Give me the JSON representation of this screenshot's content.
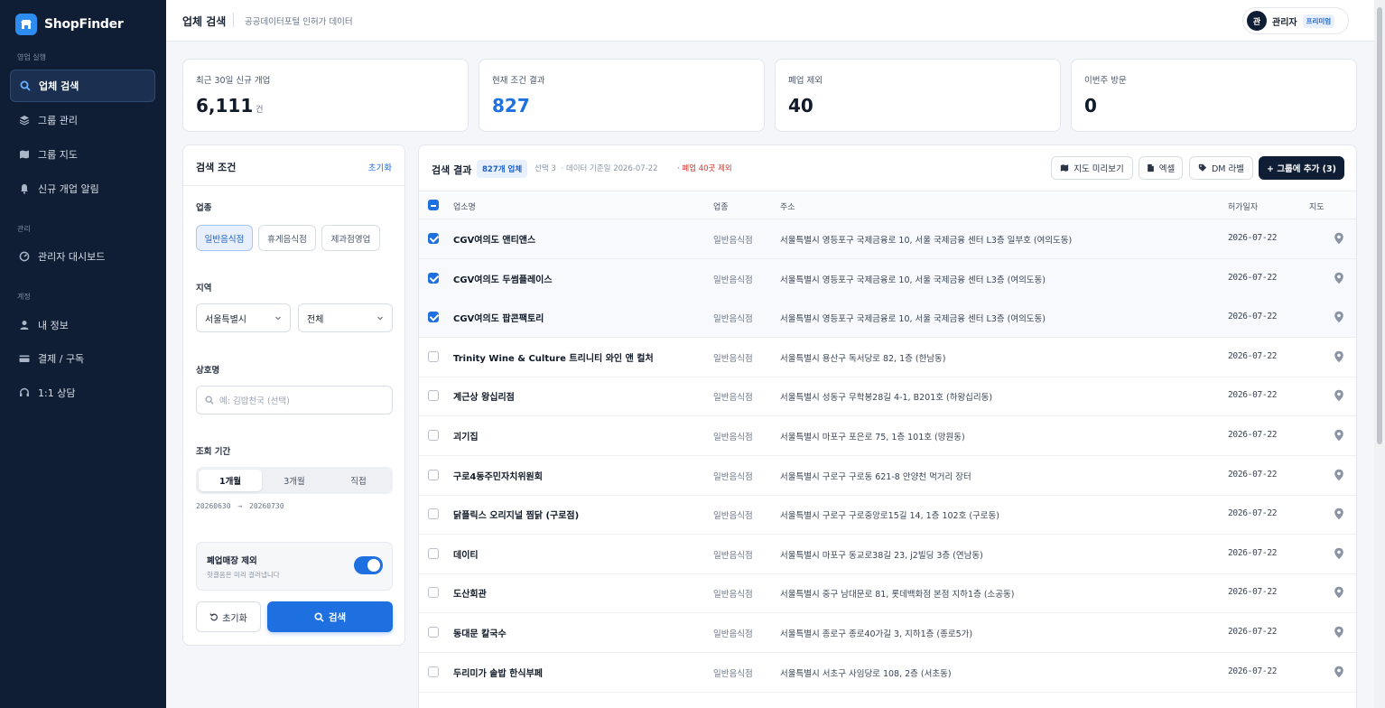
{
  "sidebar": {
    "brand": "ShopFinder",
    "sections": {
      "sales": "영업 실행",
      "manage": "관리",
      "account": "계정"
    },
    "items": [
      {
        "label": "업체 검색",
        "icon": "search-icon"
      },
      {
        "label": "그룹 관리",
        "icon": "layers-icon"
      },
      {
        "label": "그룹 지도",
        "icon": "map-icon"
      },
      {
        "label": "신규 개업 알림",
        "icon": "bell-icon"
      },
      {
        "label": "관리자 대시보드",
        "icon": "gauge-icon"
      },
      {
        "label": "내 정보",
        "icon": "user-icon"
      },
      {
        "label": "결제 / 구독",
        "icon": "card-icon"
      },
      {
        "label": "1:1 상담",
        "icon": "headset-icon"
      }
    ]
  },
  "topbar": {
    "title": "업체 검색",
    "subtitle": "공공데이터포털 인허가 데이터",
    "user_initial": "관",
    "user_name": "관리자",
    "user_badge": "프리미엄"
  },
  "stats": [
    {
      "label": "최근 30일 신규 개업",
      "value": "6,111",
      "unit": "건"
    },
    {
      "label": "현재 조건 결과",
      "value": "827",
      "unit": ""
    },
    {
      "label": "폐업 제외",
      "value": "40",
      "unit": ""
    },
    {
      "label": "이번주 방문",
      "value": "0",
      "unit": ""
    }
  ],
  "filter": {
    "title": "검색 조건",
    "reset_link": "초기화",
    "industry_label": "업종",
    "industries": [
      "일반음식점",
      "휴게음식점",
      "제과점영업"
    ],
    "region_label": "지역",
    "region_city": "서울특별시",
    "region_district": "전체",
    "name_label": "상호명",
    "name_placeholder": "예: 김밥천국 (선택)",
    "period_label": "조회 기간",
    "periods": [
      "1개월",
      "3개월",
      "직접"
    ],
    "range_from": "20260630",
    "range_arrow": "→",
    "range_to": "20260730",
    "closed_title": "폐업매장 제외",
    "closed_desc": "핫결음은 미리 걸러냅니다",
    "reset_button": "초기화",
    "search_button": "검색"
  },
  "results": {
    "title": "검색 결과",
    "count": "827개 업체",
    "selected": "선택 3",
    "data_date": "· 데이터 기준일 2026-07-22",
    "closed_note": "· 폐업 40곳 제외",
    "buttons": {
      "map_preview": "지도 미리보기",
      "excel": "엑셀",
      "dm_label": "DM 라벨",
      "add_group": "+ 그룹에 추가 (3)"
    },
    "columns": {
      "name": "업소명",
      "type": "업종",
      "address": "주소",
      "date": "허가일자",
      "map": "지도"
    },
    "rows": [
      {
        "name": "CGV여의도 앤티앤스",
        "type": "일반음식점",
        "address": "서울특별시 영등포구 국제금융로 10, 서울 국제금융 센터 L3층 일부호 (여의도동)",
        "date": "2026-07-22",
        "checked": true
      },
      {
        "name": "CGV여의도 두썸플레이스",
        "type": "일반음식점",
        "address": "서울특별시 영등포구 국제금융로 10, 서울 국제금융 센터 L3층 (여의도동)",
        "date": "2026-07-22",
        "checked": true
      },
      {
        "name": "CGV여의도 팝콘팩토리",
        "type": "일반음식점",
        "address": "서울특별시 영등포구 국제금융로 10, 서울 국제금융 센터 L3층 (여의도동)",
        "date": "2026-07-22",
        "checked": true
      },
      {
        "name": "Trinity Wine & Culture 트리니티 와인 앤 컬처",
        "type": "일반음식점",
        "address": "서울특별시 용산구 독서당로 82, 1층 (한남동)",
        "date": "2026-07-22",
        "checked": false
      },
      {
        "name": "계근상 왕십리점",
        "type": "일반음식점",
        "address": "서울특별시 성동구 무학봉28길 4-1, B201호 (하왕십리동)",
        "date": "2026-07-22",
        "checked": false
      },
      {
        "name": "괴기집",
        "type": "일반음식점",
        "address": "서울특별시 마포구 포은로 75, 1층 101호 (망원동)",
        "date": "2026-07-22",
        "checked": false
      },
      {
        "name": "구로4동주민자치위원회",
        "type": "일반음식점",
        "address": "서울특별시 구로구 구로동 621-8 안양천 먹거리 장터",
        "date": "2026-07-22",
        "checked": false
      },
      {
        "name": "닭플릭스 오리지널 찜닭 (구로점)",
        "type": "일반음식점",
        "address": "서울특별시 구로구 구로중앙로15길 14, 1층 102호 (구로동)",
        "date": "2026-07-22",
        "checked": false
      },
      {
        "name": "데이티",
        "type": "일반음식점",
        "address": "서울특별시 마포구 동교로38길 23, j2빌딩 3층 (연남동)",
        "date": "2026-07-22",
        "checked": false
      },
      {
        "name": "도산회관",
        "type": "일반음식점",
        "address": "서울특별시 중구 남대문로 81, 롯데백화점 본점 지하1층 (소공동)",
        "date": "2026-07-22",
        "checked": false
      },
      {
        "name": "동대문 칼국수",
        "type": "일반음식점",
        "address": "서울특별시 종로구 종로40가길 3, 지하1층 (종로5가)",
        "date": "2026-07-22",
        "checked": false
      },
      {
        "name": "두리미가 솥밥 한식부페",
        "type": "일반음식점",
        "address": "서울특별시 서초구 사임당로 108, 2층 (서초동)",
        "date": "2026-07-22",
        "checked": false
      }
    ]
  },
  "colors": {
    "sidebar_bg": "#0f1e34",
    "accent": "#1e6fe0",
    "warn": "#d0342c"
  }
}
